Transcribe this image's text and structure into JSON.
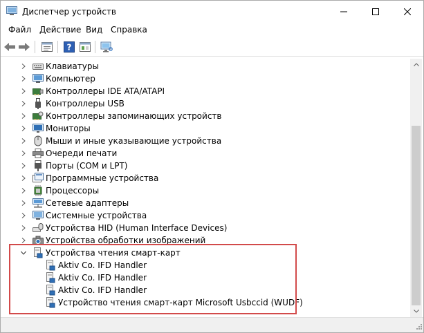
{
  "window": {
    "title": "Диспетчер устройств",
    "icon": "device-manager-icon",
    "controls": [
      "minimize-icon",
      "maximize-icon",
      "close-icon"
    ]
  },
  "menu": [
    {
      "label": "Файл"
    },
    {
      "label": "Действие"
    },
    {
      "label": "Вид"
    },
    {
      "label": "Справка"
    }
  ],
  "toolbar": {
    "buttons": [
      "back-arrow-icon",
      "forward-arrow-icon",
      "properties-icon",
      "help-icon",
      "view-icon",
      "monitor-scan-icon"
    ]
  },
  "tree": {
    "categories": [
      {
        "label": "Клавиатуры",
        "icon": "keyboard-icon"
      },
      {
        "label": "Компьютер",
        "icon": "computer-icon"
      },
      {
        "label": "Контроллеры IDE ATA/ATAPI",
        "icon": "ide-controller-icon"
      },
      {
        "label": "Контроллеры USB",
        "icon": "usb-icon"
      },
      {
        "label": "Контроллеры запоминающих устройств",
        "icon": "storage-controller-icon"
      },
      {
        "label": "Мониторы",
        "icon": "monitor-icon"
      },
      {
        "label": "Мыши и иные указывающие устройства",
        "icon": "mouse-icon"
      },
      {
        "label": "Очереди печати",
        "icon": "printer-icon"
      },
      {
        "label": "Порты (COM и LPT)",
        "icon": "port-icon"
      },
      {
        "label": "Программные устройства",
        "icon": "software-device-icon"
      },
      {
        "label": "Процессоры",
        "icon": "processor-icon"
      },
      {
        "label": "Сетевые адаптеры",
        "icon": "network-adapter-icon"
      },
      {
        "label": "Системные устройства",
        "icon": "system-device-icon"
      },
      {
        "label": "Устройства HID (Human Interface Devices)",
        "icon": "hid-icon"
      },
      {
        "label": "Устройства обработки изображений",
        "icon": "imaging-device-icon"
      }
    ],
    "expanded": {
      "label": "Устройства чтения смарт-карт",
      "icon": "smart-card-reader-icon",
      "children": [
        {
          "label": "Aktiv Co. IFD Handler",
          "icon": "smart-card-reader-icon"
        },
        {
          "label": "Aktiv Co. IFD Handler",
          "icon": "smart-card-reader-icon"
        },
        {
          "label": "Aktiv Co. IFD Handler",
          "icon": "smart-card-reader-icon"
        },
        {
          "label": "Устройство чтения смарт-карт Microsoft Usbccid (WUDF)",
          "icon": "smart-card-reader-icon"
        }
      ]
    }
  },
  "colors": {
    "highlight_border": "#d24a4a",
    "scrollbar_track": "#f0f0f0",
    "scrollbar_thumb": "#cdcdcd"
  }
}
